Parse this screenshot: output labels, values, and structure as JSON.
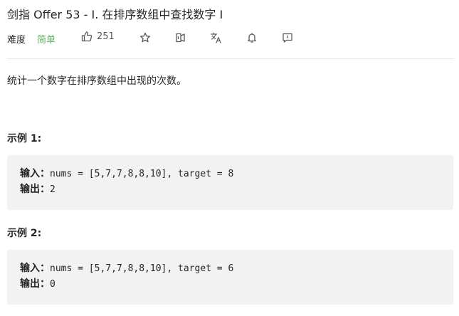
{
  "problem": {
    "title": "剑指 Offer 53 - I. 在排序数组中查找数字 I",
    "difficulty_label": "难度",
    "difficulty_value": "简单",
    "likes": "251",
    "description": "统计一个数字在排序数组中出现的次数。"
  },
  "toolbar": {
    "icons": [
      "thumbs-up-icon",
      "star-icon",
      "share-icon",
      "translate-icon",
      "bell-icon",
      "feedback-icon"
    ]
  },
  "colors": {
    "easy": "#5cb85c",
    "code_bg": "#f2f2f2",
    "divider": "#e8e8e8",
    "text": "#262626",
    "icon": "#595959"
  },
  "examples": [
    {
      "heading": "示例 1:",
      "input_label": "输入：",
      "input_value": "nums = [5,7,7,8,8,10], target = 8",
      "output_label": "输出：",
      "output_value": "2"
    },
    {
      "heading": "示例 2:",
      "input_label": "输入：",
      "input_value": "nums = [5,7,7,8,8,10], target = 6",
      "output_label": "输出：",
      "output_value": "0"
    }
  ]
}
